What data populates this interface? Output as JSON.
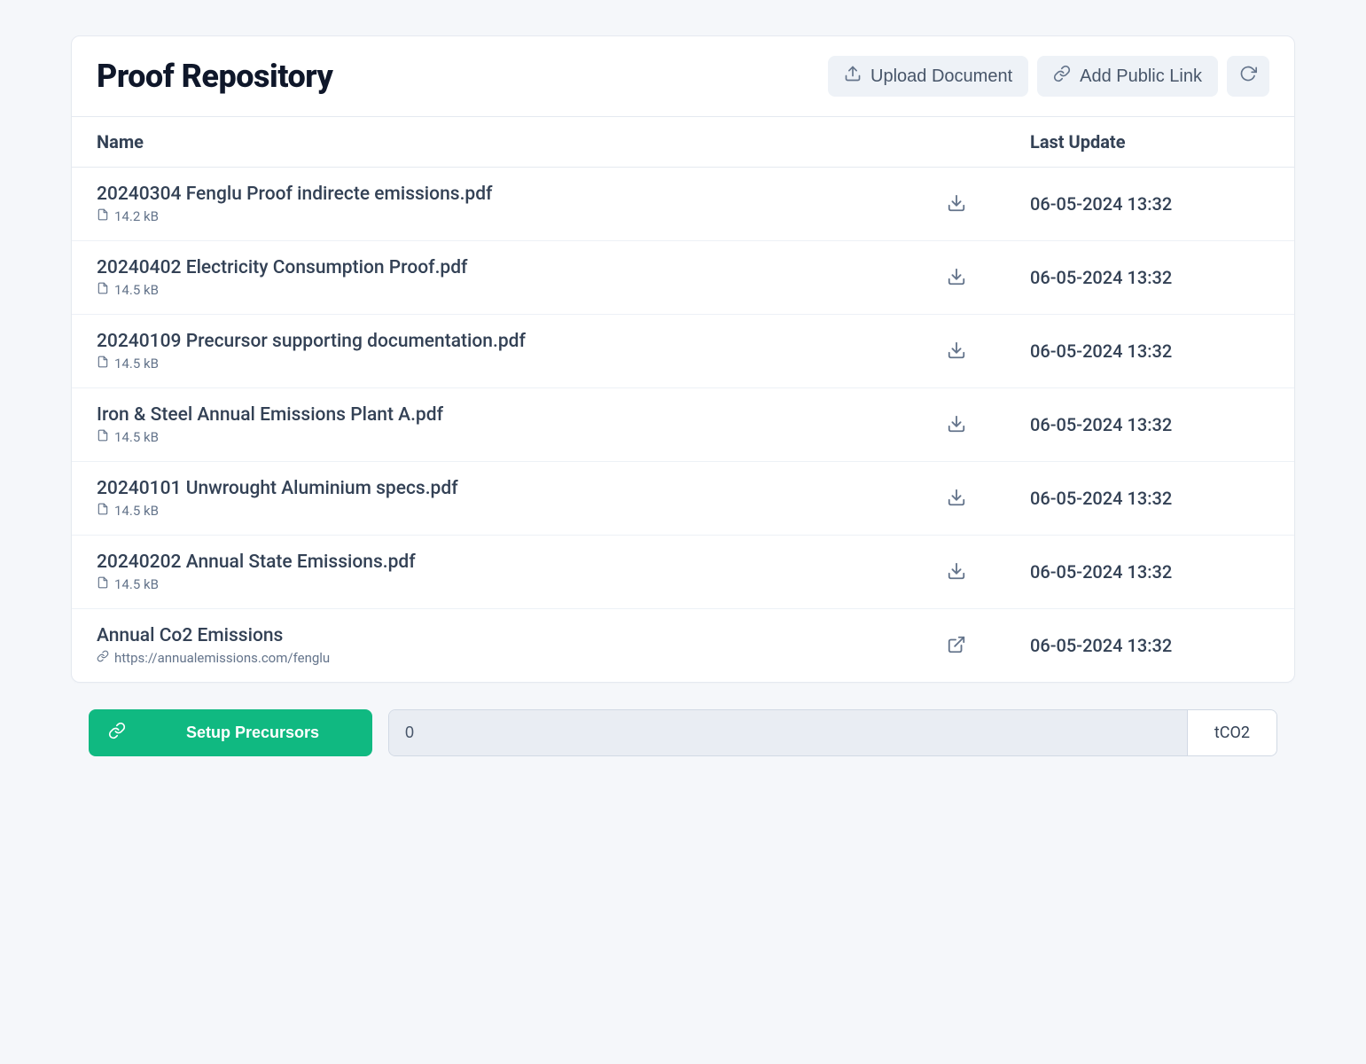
{
  "header": {
    "title": "Proof Repository",
    "upload_label": "Upload Document",
    "link_label": "Add Public Link"
  },
  "columns": {
    "name": "Name",
    "last_update": "Last Update"
  },
  "items": [
    {
      "name": "20240304 Fenglu Proof indirecte emissions.pdf",
      "size": "14.2 kB",
      "type": "file",
      "date": "06-05-2024 13:32"
    },
    {
      "name": "20240402 Electricity Consumption Proof.pdf",
      "size": "14.5 kB",
      "type": "file",
      "date": "06-05-2024 13:32"
    },
    {
      "name": "20240109 Precursor supporting documentation.pdf",
      "size": "14.5 kB",
      "type": "file",
      "date": "06-05-2024 13:32"
    },
    {
      "name": "Iron & Steel Annual Emissions Plant A.pdf",
      "size": "14.5 kB",
      "type": "file",
      "date": "06-05-2024 13:32"
    },
    {
      "name": "20240101 Unwrought Aluminium specs.pdf",
      "size": "14.5 kB",
      "type": "file",
      "date": "06-05-2024 13:32"
    },
    {
      "name": "20240202 Annual State Emissions.pdf",
      "size": "14.5 kB",
      "type": "file",
      "date": "06-05-2024 13:32"
    },
    {
      "name": "Annual Co2 Emissions",
      "url": "https://annualemissions.com/fenglu",
      "type": "link",
      "date": "06-05-2024 13:32"
    }
  ],
  "footer": {
    "setup_label": "Setup Precursors",
    "input_value": "0",
    "unit_label": "tCO2"
  }
}
